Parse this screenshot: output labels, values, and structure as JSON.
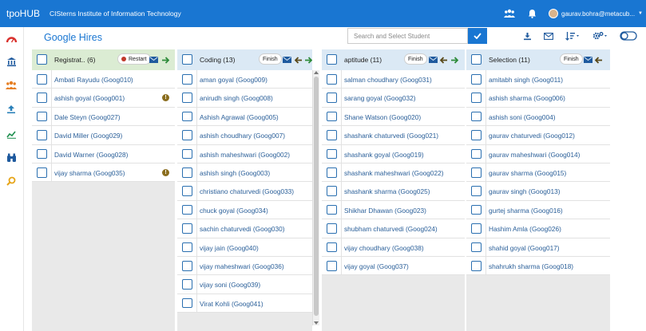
{
  "app": {
    "brand": "tpoHUB",
    "institute": "CISterns Institute of Information Technology"
  },
  "topbar": {
    "user_email": "gaurav.bohra@metacub...",
    "icons": [
      "group-icon",
      "bell-icon"
    ]
  },
  "sidebar": {
    "icons": [
      "dashboard-icon",
      "institution-icon",
      "users-icon",
      "upload-icon",
      "analytics-icon",
      "binoculars-icon",
      "search-icon"
    ]
  },
  "page": {
    "title": "Google Hires"
  },
  "search": {
    "placeholder": "Search and Select Student",
    "value": ""
  },
  "toolbar_icons": [
    "download-icon",
    "mail-icon",
    "sort-icon",
    "settings-icon",
    "toggle-icon"
  ],
  "colors": {
    "topbar": "#1976d2",
    "col_registration": "#dbecd3",
    "col_default": "#dbe9f5",
    "link": "#2a5f99",
    "warning": "#8a6d1e"
  },
  "columns": [
    {
      "title": "Registrat.. (6)",
      "action": "Restart",
      "rows": [
        {
          "name": "Ambati Rayudu (Goog010)",
          "warn": false
        },
        {
          "name": "ashish goyal (Goog001)",
          "warn": true
        },
        {
          "name": "Dale Steyn (Goog027)",
          "warn": false
        },
        {
          "name": "David Miller (Goog029)",
          "warn": false
        },
        {
          "name": "David Warner (Goog028)",
          "warn": false
        },
        {
          "name": "vijay sharma (Goog035)",
          "warn": true
        }
      ]
    },
    {
      "title": "Coding (13)",
      "action": "Finish",
      "rows": [
        {
          "name": "aman goyal (Goog009)"
        },
        {
          "name": "anirudh singh (Goog008)"
        },
        {
          "name": "Ashish Agrawal (Goog005)"
        },
        {
          "name": "ashish choudhary (Goog007)"
        },
        {
          "name": "ashish maheshwari (Goog002)"
        },
        {
          "name": "ashish singh (Goog003)"
        },
        {
          "name": "christiano chaturvedi (Goog033)"
        },
        {
          "name": "chuck goyal (Goog034)"
        },
        {
          "name": "sachin chaturvedi (Goog030)"
        },
        {
          "name": "vijay jain (Goog040)"
        },
        {
          "name": "vijay maheshwari (Goog036)"
        },
        {
          "name": "vijay soni (Goog039)"
        },
        {
          "name": "Virat Kohli (Goog041)"
        }
      ]
    },
    {
      "title": "aptitude (11)",
      "action": "Finish",
      "rows": [
        {
          "name": "salman choudhary (Goog031)"
        },
        {
          "name": "sarang goyal (Goog032)"
        },
        {
          "name": "Shane Watson (Goog020)"
        },
        {
          "name": "shashank chaturvedi (Goog021)"
        },
        {
          "name": "shashank goyal (Goog019)"
        },
        {
          "name": "shashank maheshwari (Goog022)"
        },
        {
          "name": "shashank sharma (Goog025)"
        },
        {
          "name": "Shikhar Dhawan (Goog023)"
        },
        {
          "name": "shubham chaturvedi (Goog024)"
        },
        {
          "name": "vijay choudhary (Goog038)"
        },
        {
          "name": "vijay goyal (Goog037)"
        }
      ]
    },
    {
      "title": "Selection (11)",
      "action": "Finish",
      "rows": [
        {
          "name": "amitabh singh (Goog011)"
        },
        {
          "name": "ashish sharma (Goog006)"
        },
        {
          "name": "ashish soni (Goog004)"
        },
        {
          "name": "gaurav chaturvedi (Goog012)"
        },
        {
          "name": "gaurav maheshwari (Goog014)"
        },
        {
          "name": "gaurav sharma (Goog015)"
        },
        {
          "name": "gaurav singh (Goog013)"
        },
        {
          "name": "gurtej sharma (Goog016)"
        },
        {
          "name": "Hashim Amla (Goog026)"
        },
        {
          "name": "shahid goyal (Goog017)"
        },
        {
          "name": "shahrukh sharma (Goog018)"
        }
      ]
    }
  ]
}
